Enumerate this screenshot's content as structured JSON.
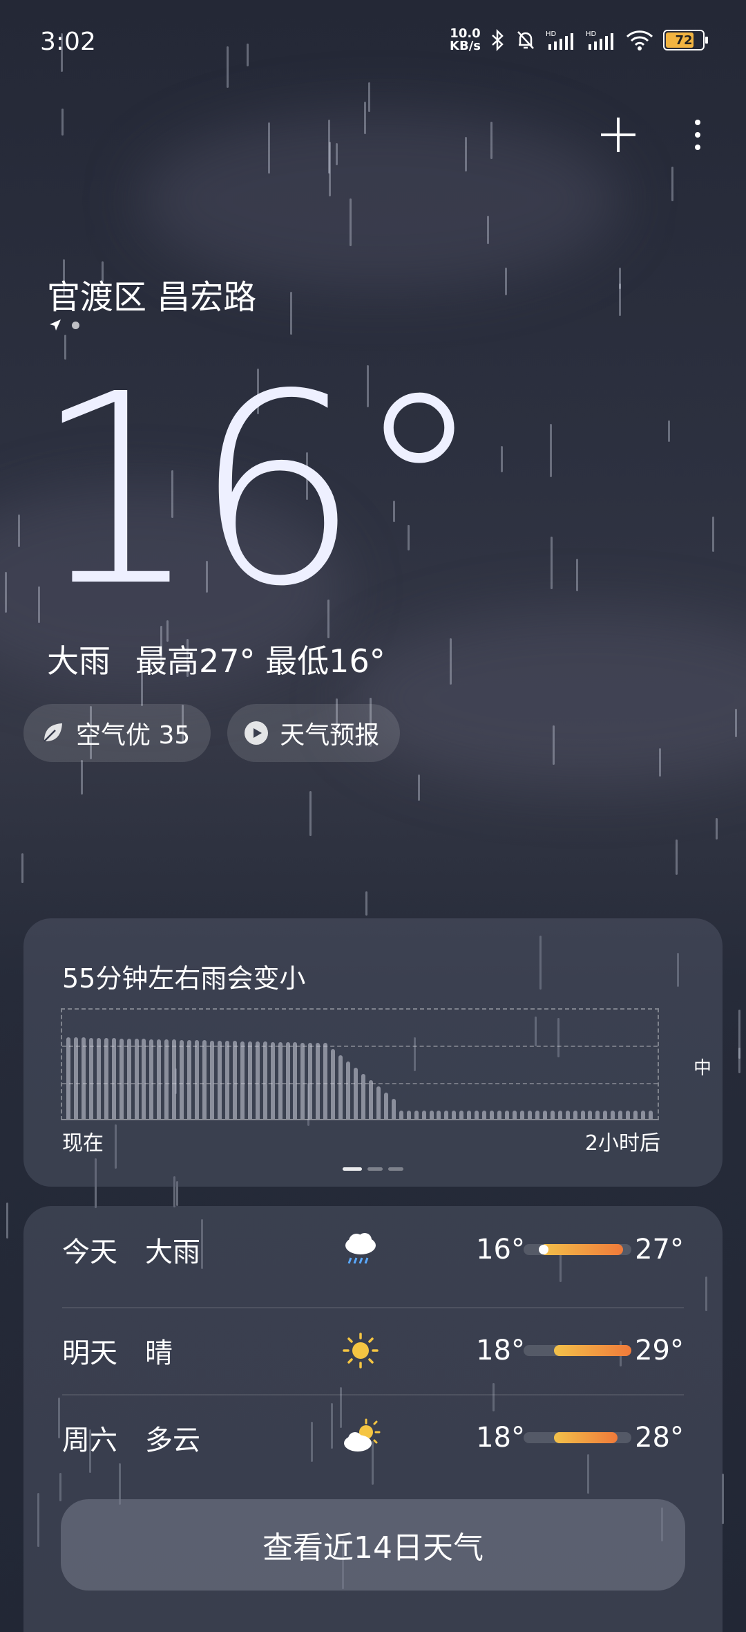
{
  "status_bar": {
    "time": "3:02",
    "net_speed_value": "10.0",
    "net_speed_unit": "KB/s",
    "icons": [
      "bluetooth-icon",
      "mute-bell-icon",
      "signal-hd-icon",
      "signal-hd-icon",
      "wifi-icon"
    ],
    "battery": "72"
  },
  "header": {
    "location": "官渡区 昌宏路"
  },
  "current": {
    "temperature": "16°",
    "condition": "大雨",
    "high_label": "最高27°",
    "low_label": "最低16°"
  },
  "chips": {
    "air_quality": "空气优 35",
    "forecast_video": "天气预报"
  },
  "rain_card": {
    "title": "55分钟左右雨会变小",
    "level_label": "中",
    "x_start": "现在",
    "x_end": "2小时后"
  },
  "forecast": {
    "days": [
      {
        "day": "今天",
        "condition": "大雨",
        "icon": "rain-cloud-icon",
        "low": "16°",
        "high": "27°"
      },
      {
        "day": "明天",
        "condition": "晴",
        "icon": "sun-icon",
        "low": "18°",
        "high": "29°"
      },
      {
        "day": "周六",
        "condition": "多云",
        "icon": "partly-cloudy-icon",
        "low": "18°",
        "high": "28°"
      }
    ],
    "cta_label": "查看近14日天气"
  },
  "colors": {
    "accent_gradient_start": "#f2c14a",
    "accent_gradient_end": "#f07a3a",
    "battery": "#f2b441"
  }
}
